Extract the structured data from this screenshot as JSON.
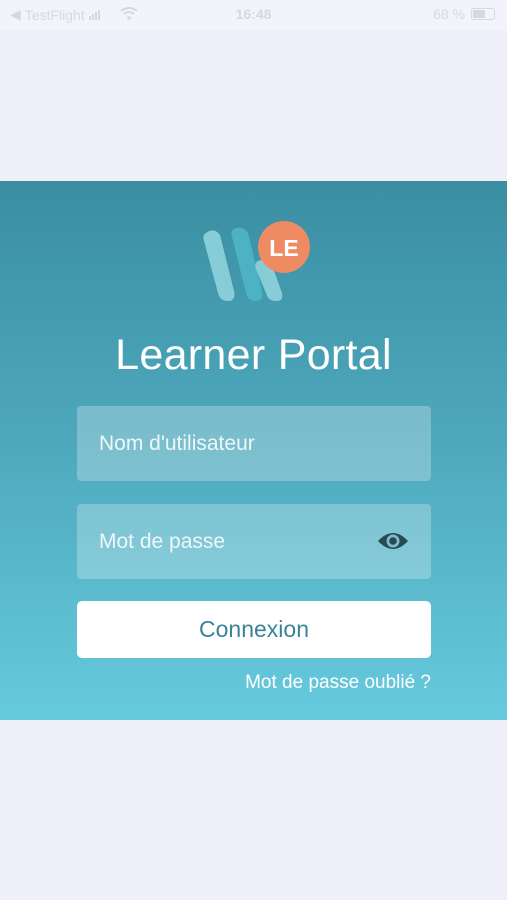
{
  "status_bar": {
    "back_app": "TestFlight",
    "time": "16:48",
    "battery": "68 %"
  },
  "logo": {
    "badge_text": "LE",
    "colors": {
      "mark_light": "#8fd3dd",
      "mark_mid": "#4fb3c6",
      "badge": "#ef8b63"
    }
  },
  "app_title": "Learner Portal",
  "form": {
    "username": {
      "value": "",
      "placeholder": "Nom d'utilisateur"
    },
    "password": {
      "value": "",
      "placeholder": "Mot de passe",
      "toggle_icon": "eye-icon"
    },
    "submit_label": "Connexion",
    "forgot_label": "Mot de passe oublié ?"
  },
  "colors": {
    "page_background": "#eeeff9",
    "gradient_top": "#3a8ea2",
    "gradient_bottom": "#66cade",
    "button_text": "#3b8398"
  }
}
